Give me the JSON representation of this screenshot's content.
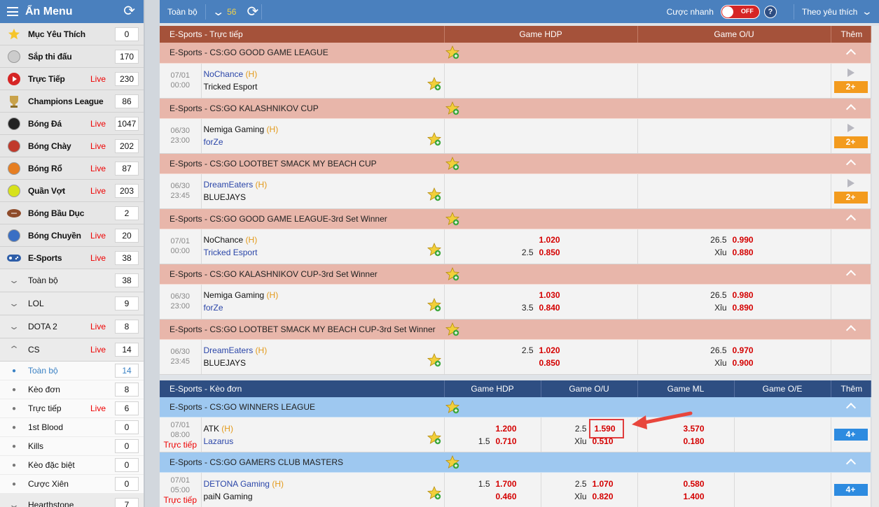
{
  "sidebar": {
    "title": "Ẩn Menu",
    "sports": [
      {
        "name": "Mục Yêu Thích",
        "live": "",
        "count": "0",
        "icon": "star-icon",
        "color": "#f6c52a"
      },
      {
        "name": "Sắp thi đấu",
        "live": "",
        "count": "170",
        "icon": "clock-icon",
        "color": "#cccccc"
      },
      {
        "name": "Trực Tiếp",
        "live": "Live",
        "count": "230",
        "icon": "play-icon",
        "color": "#d62525"
      },
      {
        "name": "Champions League",
        "live": "",
        "count": "86",
        "icon": "trophy-icon",
        "color": "#c9a24a"
      },
      {
        "name": "Bóng Đá",
        "live": "Live",
        "count": "1047",
        "icon": "soccer-ball-icon",
        "color": "#222222"
      },
      {
        "name": "Bóng Chày",
        "live": "Live",
        "count": "202",
        "icon": "baseball-icon",
        "color": "#c0392b"
      },
      {
        "name": "Bóng Rổ",
        "live": "Live",
        "count": "87",
        "icon": "basketball-icon",
        "color": "#e67e22"
      },
      {
        "name": "Quần Vợt",
        "live": "Live",
        "count": "203",
        "icon": "tennis-ball-icon",
        "color": "#d7e21b"
      },
      {
        "name": "Bóng Bầu Dục",
        "live": "",
        "count": "2",
        "icon": "rugby-ball-icon",
        "color": "#8e4b2a"
      },
      {
        "name": "Bóng Chuyền",
        "live": "Live",
        "count": "20",
        "icon": "volleyball-icon",
        "color": "#3a6fc4"
      },
      {
        "name": "E-Sports",
        "live": "Live",
        "count": "38",
        "icon": "gamepad-icon",
        "color": "#2d5da8"
      }
    ],
    "esports_subs": [
      {
        "name": "Toàn bộ",
        "live": "",
        "count": "38"
      },
      {
        "name": "LOL",
        "live": "",
        "count": "9"
      },
      {
        "name": "DOTA 2",
        "live": "Live",
        "count": "8"
      },
      {
        "name": "CS",
        "live": "Live",
        "count": "14",
        "open": true
      }
    ],
    "cs_subs": [
      {
        "name": "Toàn bộ",
        "live": "",
        "count": "14",
        "selected": true
      },
      {
        "name": "Kèo đơn",
        "live": "",
        "count": "8"
      },
      {
        "name": "Trực tiếp",
        "live": "Live",
        "count": "6"
      },
      {
        "name": "1st Blood",
        "live": "",
        "count": "0"
      },
      {
        "name": "Kills",
        "live": "",
        "count": "0"
      },
      {
        "name": "Kèo đặc biệt",
        "live": "",
        "count": "0"
      },
      {
        "name": "Cược Xiên",
        "live": "",
        "count": "0"
      }
    ],
    "next_sub": {
      "name": "Hearthstone",
      "count": "7"
    }
  },
  "topbar": {
    "all_label": "Toàn bộ",
    "count": "56",
    "quick_bet_label": "Cược nhanh",
    "toggle_label": "OFF",
    "help": "?",
    "sort_label": "Theo yêu thích"
  },
  "live_section": {
    "title": "E-Sports - Trực tiếp",
    "col_hdp": "Game HDP",
    "col_ou": "Game O/U",
    "col_more": "Thêm",
    "leagues": [
      {
        "name": "E-Sports - CS:GO GOOD GAME LEAGUE",
        "match": {
          "date": "07/01",
          "time": "00:00",
          "home": "NoChance",
          "home_tag": "(H)",
          "away": "Tricked Esport",
          "home_color": "blue",
          "away_color": "blk",
          "hdp": [],
          "ou": [],
          "more": "2+"
        }
      },
      {
        "name": "E-Sports - CS:GO KALASHNIKOV CUP",
        "match": {
          "date": "06/30",
          "time": "23:00",
          "home": "Nemiga Gaming",
          "home_tag": "(H)",
          "away": "forZe",
          "home_color": "blk",
          "away_color": "blue",
          "hdp": [],
          "ou": [],
          "more": "2+"
        }
      },
      {
        "name": "E-Sports - CS:GO LOOTBET SMACK MY BEACH CUP",
        "match": {
          "date": "06/30",
          "time": "23:45",
          "home": "DreamEaters",
          "home_tag": "(H)",
          "away": "BLUEJAYS",
          "home_color": "blue",
          "away_color": "blk",
          "hdp": [],
          "ou": [],
          "more": "2+"
        }
      },
      {
        "name": "E-Sports - CS:GO GOOD GAME LEAGUE-3rd Set Winner",
        "match": {
          "date": "07/01",
          "time": "00:00",
          "home": "NoChance",
          "home_tag": "(H)",
          "away": "Tricked Esport",
          "home_color": "blk",
          "away_color": "blue",
          "hdp": [
            {
              "k": "",
              "v": "1.020"
            },
            {
              "k": "2.5",
              "v": "0.850"
            }
          ],
          "ou": [
            {
              "k": "26.5",
              "v": "0.990"
            },
            {
              "k": "Xỉu",
              "v": "0.880"
            }
          ],
          "more": ""
        }
      },
      {
        "name": "E-Sports - CS:GO KALASHNIKOV CUP-3rd Set Winner",
        "match": {
          "date": "06/30",
          "time": "23:00",
          "home": "Nemiga Gaming",
          "home_tag": "(H)",
          "away": "forZe",
          "home_color": "blk",
          "away_color": "blue",
          "hdp": [
            {
              "k": "",
              "v": "1.030"
            },
            {
              "k": "3.5",
              "v": "0.840"
            }
          ],
          "ou": [
            {
              "k": "26.5",
              "v": "0.980"
            },
            {
              "k": "Xỉu",
              "v": "0.890"
            }
          ],
          "more": ""
        }
      },
      {
        "name": "E-Sports - CS:GO LOOTBET SMACK MY BEACH CUP-3rd Set Winner",
        "match": {
          "date": "06/30",
          "time": "23:45",
          "home": "DreamEaters",
          "home_tag": "(H)",
          "away": "BLUEJAYS",
          "home_color": "blue",
          "away_color": "blk",
          "hdp": [
            {
              "k": "2.5",
              "v": "1.020"
            },
            {
              "k": "",
              "v": "0.850"
            }
          ],
          "ou": [
            {
              "k": "26.5",
              "v": "0.970"
            },
            {
              "k": "Xỉu",
              "v": "0.900"
            }
          ],
          "more": ""
        }
      }
    ]
  },
  "single_section": {
    "title": "E-Sports - Kèo đơn",
    "col_hdp": "Game HDP",
    "col_ou": "Game O/U",
    "col_ml": "Game ML",
    "col_oe": "Game O/E",
    "col_more": "Thêm",
    "leagues": [
      {
        "name": "E-Sports - CS:GO WINNERS LEAGUE",
        "match": {
          "date": "07/01",
          "time": "08:00",
          "live": "Trực tiếp",
          "home": "ATK",
          "home_tag": "(H)",
          "away": "Lazarus",
          "home_color": "blk",
          "away_color": "blue",
          "hdp": [
            {
              "k": "",
              "v": "1.200"
            },
            {
              "k": "1.5",
              "v": "0.710"
            }
          ],
          "ou": [
            {
              "k": "2.5",
              "v": "1.590",
              "highlight": true
            },
            {
              "k": "Xỉu",
              "v": "0.510"
            }
          ],
          "ml": [
            {
              "k": "",
              "v": "3.570"
            },
            {
              "k": "",
              "v": "0.180"
            }
          ],
          "more": "4+"
        }
      },
      {
        "name": "E-Sports - CS:GO GAMERS CLUB MASTERS",
        "match": {
          "date": "07/01",
          "time": "05:00",
          "live": "Trực tiếp",
          "home": "DETONA Gaming",
          "home_tag": "(H)",
          "away": "paiN Gaming",
          "home_color": "blue",
          "away_color": "blk",
          "hdp": [
            {
              "k": "1.5",
              "v": "1.700"
            },
            {
              "k": "",
              "v": "0.460"
            }
          ],
          "ou": [
            {
              "k": "2.5",
              "v": "1.070"
            },
            {
              "k": "Xỉu",
              "v": "0.820"
            }
          ],
          "ml": [
            {
              "k": "",
              "v": "0.580"
            },
            {
              "k": "",
              "v": "1.400"
            }
          ],
          "more": "4+"
        }
      }
    ]
  }
}
